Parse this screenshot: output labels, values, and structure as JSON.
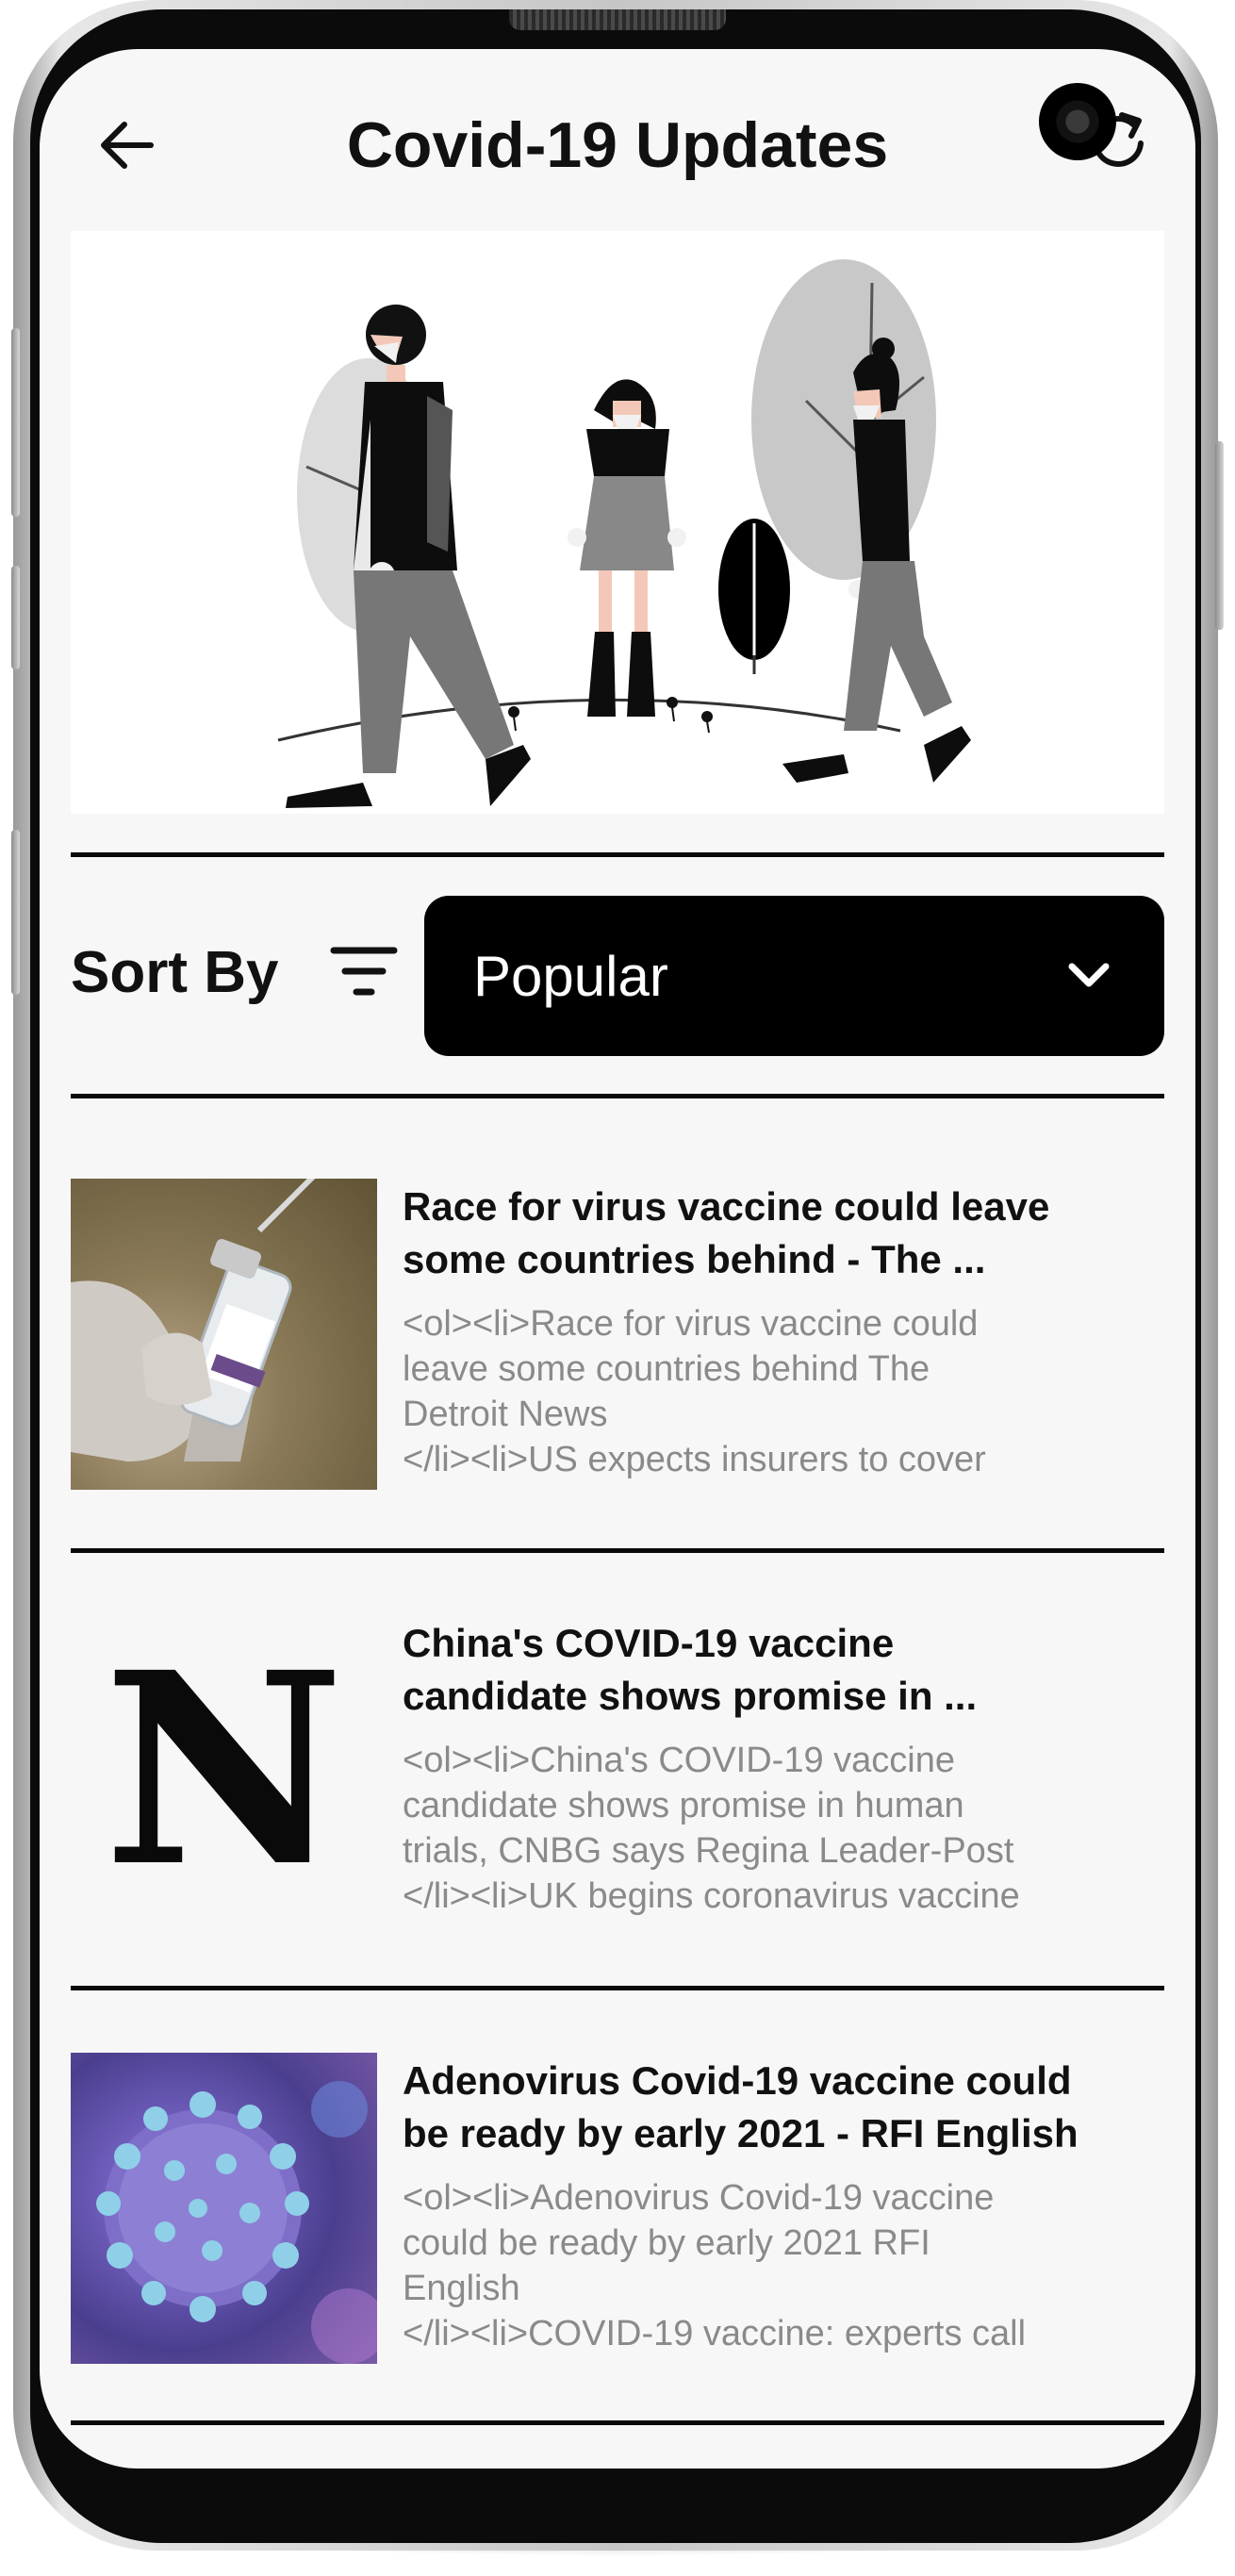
{
  "header": {
    "title": "Covid-19 Updates",
    "back_icon": "arrow-left-icon",
    "refresh_icon": "refresh-icon"
  },
  "sort": {
    "label": "Sort By",
    "filter_icon": "filter-icon",
    "selected": "Popular",
    "chevron_icon": "chevron-down-icon"
  },
  "articles": [
    {
      "title": "Race for virus vaccine could leave\nsome countries behind - The ...",
      "description": "<ol><li>Race for virus vaccine could\nleave some countries behind  The\nDetroit News\n</li><li>US expects insurers to cover",
      "thumb": "vaccine-vial-photo"
    },
    {
      "title": "China's COVID-19 vaccine\ncandidate shows promise in ...",
      "description": "<ol><li>China's COVID-19 vaccine\ncandidate shows promise in human\ntrials, CNBG says  Regina Leader-Post\n</li><li>UK begins coronavirus vaccine",
      "thumb": "N"
    },
    {
      "title": "Adenovirus Covid-19 vaccine could\nbe ready by early 2021 - RFI English",
      "description": "<ol><li>Adenovirus Covid-19 vaccine\ncould be ready by early 2021  RFI\nEnglish\n</li><li>COVID-19 vaccine: experts call",
      "thumb": "virus-illustration"
    }
  ],
  "colors": {
    "background": "#f7f7f7",
    "text": "#111111",
    "muted": "#8a8a8a",
    "accent": "#000000"
  }
}
